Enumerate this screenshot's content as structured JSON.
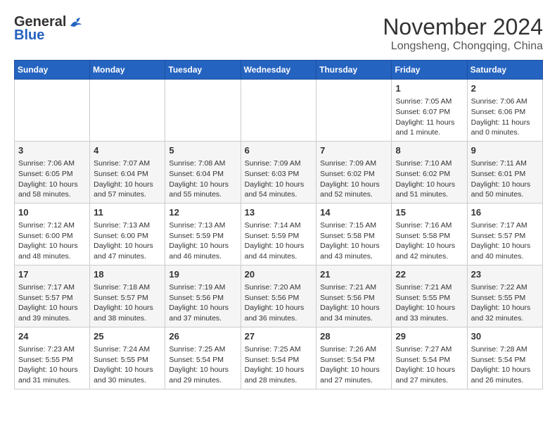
{
  "header": {
    "logo_general": "General",
    "logo_blue": "Blue",
    "month": "November 2024",
    "location": "Longsheng, Chongqing, China"
  },
  "days_of_week": [
    "Sunday",
    "Monday",
    "Tuesday",
    "Wednesday",
    "Thursday",
    "Friday",
    "Saturday"
  ],
  "weeks": [
    [
      {
        "day": "",
        "info": ""
      },
      {
        "day": "",
        "info": ""
      },
      {
        "day": "",
        "info": ""
      },
      {
        "day": "",
        "info": ""
      },
      {
        "day": "",
        "info": ""
      },
      {
        "day": "1",
        "info": "Sunrise: 7:05 AM\nSunset: 6:07 PM\nDaylight: 11 hours\nand 1 minute."
      },
      {
        "day": "2",
        "info": "Sunrise: 7:06 AM\nSunset: 6:06 PM\nDaylight: 11 hours\nand 0 minutes."
      }
    ],
    [
      {
        "day": "3",
        "info": "Sunrise: 7:06 AM\nSunset: 6:05 PM\nDaylight: 10 hours\nand 58 minutes."
      },
      {
        "day": "4",
        "info": "Sunrise: 7:07 AM\nSunset: 6:04 PM\nDaylight: 10 hours\nand 57 minutes."
      },
      {
        "day": "5",
        "info": "Sunrise: 7:08 AM\nSunset: 6:04 PM\nDaylight: 10 hours\nand 55 minutes."
      },
      {
        "day": "6",
        "info": "Sunrise: 7:09 AM\nSunset: 6:03 PM\nDaylight: 10 hours\nand 54 minutes."
      },
      {
        "day": "7",
        "info": "Sunrise: 7:09 AM\nSunset: 6:02 PM\nDaylight: 10 hours\nand 52 minutes."
      },
      {
        "day": "8",
        "info": "Sunrise: 7:10 AM\nSunset: 6:02 PM\nDaylight: 10 hours\nand 51 minutes."
      },
      {
        "day": "9",
        "info": "Sunrise: 7:11 AM\nSunset: 6:01 PM\nDaylight: 10 hours\nand 50 minutes."
      }
    ],
    [
      {
        "day": "10",
        "info": "Sunrise: 7:12 AM\nSunset: 6:00 PM\nDaylight: 10 hours\nand 48 minutes."
      },
      {
        "day": "11",
        "info": "Sunrise: 7:13 AM\nSunset: 6:00 PM\nDaylight: 10 hours\nand 47 minutes."
      },
      {
        "day": "12",
        "info": "Sunrise: 7:13 AM\nSunset: 5:59 PM\nDaylight: 10 hours\nand 46 minutes."
      },
      {
        "day": "13",
        "info": "Sunrise: 7:14 AM\nSunset: 5:59 PM\nDaylight: 10 hours\nand 44 minutes."
      },
      {
        "day": "14",
        "info": "Sunrise: 7:15 AM\nSunset: 5:58 PM\nDaylight: 10 hours\nand 43 minutes."
      },
      {
        "day": "15",
        "info": "Sunrise: 7:16 AM\nSunset: 5:58 PM\nDaylight: 10 hours\nand 42 minutes."
      },
      {
        "day": "16",
        "info": "Sunrise: 7:17 AM\nSunset: 5:57 PM\nDaylight: 10 hours\nand 40 minutes."
      }
    ],
    [
      {
        "day": "17",
        "info": "Sunrise: 7:17 AM\nSunset: 5:57 PM\nDaylight: 10 hours\nand 39 minutes."
      },
      {
        "day": "18",
        "info": "Sunrise: 7:18 AM\nSunset: 5:57 PM\nDaylight: 10 hours\nand 38 minutes."
      },
      {
        "day": "19",
        "info": "Sunrise: 7:19 AM\nSunset: 5:56 PM\nDaylight: 10 hours\nand 37 minutes."
      },
      {
        "day": "20",
        "info": "Sunrise: 7:20 AM\nSunset: 5:56 PM\nDaylight: 10 hours\nand 36 minutes."
      },
      {
        "day": "21",
        "info": "Sunrise: 7:21 AM\nSunset: 5:56 PM\nDaylight: 10 hours\nand 34 minutes."
      },
      {
        "day": "22",
        "info": "Sunrise: 7:21 AM\nSunset: 5:55 PM\nDaylight: 10 hours\nand 33 minutes."
      },
      {
        "day": "23",
        "info": "Sunrise: 7:22 AM\nSunset: 5:55 PM\nDaylight: 10 hours\nand 32 minutes."
      }
    ],
    [
      {
        "day": "24",
        "info": "Sunrise: 7:23 AM\nSunset: 5:55 PM\nDaylight: 10 hours\nand 31 minutes."
      },
      {
        "day": "25",
        "info": "Sunrise: 7:24 AM\nSunset: 5:55 PM\nDaylight: 10 hours\nand 30 minutes."
      },
      {
        "day": "26",
        "info": "Sunrise: 7:25 AM\nSunset: 5:54 PM\nDaylight: 10 hours\nand 29 minutes."
      },
      {
        "day": "27",
        "info": "Sunrise: 7:25 AM\nSunset: 5:54 PM\nDaylight: 10 hours\nand 28 minutes."
      },
      {
        "day": "28",
        "info": "Sunrise: 7:26 AM\nSunset: 5:54 PM\nDaylight: 10 hours\nand 27 minutes."
      },
      {
        "day": "29",
        "info": "Sunrise: 7:27 AM\nSunset: 5:54 PM\nDaylight: 10 hours\nand 27 minutes."
      },
      {
        "day": "30",
        "info": "Sunrise: 7:28 AM\nSunset: 5:54 PM\nDaylight: 10 hours\nand 26 minutes."
      }
    ]
  ]
}
